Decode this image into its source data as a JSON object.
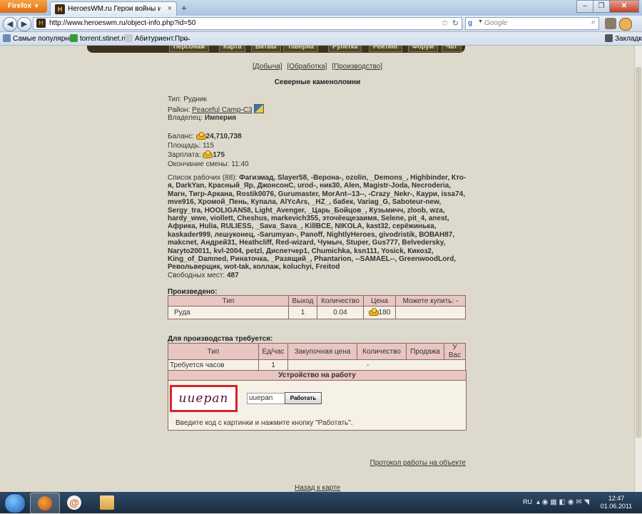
{
  "browser": {
    "app_button": "Firefox",
    "tab_title": "HeroesWM.ru Герои войны и денег. О...",
    "url": "http://www.heroeswm.ru/object-info.php?id=50",
    "search_placeholder": "Google",
    "search_engine_icon": "g",
    "bookmarks": [
      "Самые популярные",
      "torrent.stinet.ru",
      "Абитуриент.Про",
      "..."
    ],
    "bookmarks_menu": "Закладки"
  },
  "game_menu": [
    "Персонаж",
    "Карта",
    "Битвы",
    "Таверна",
    "Рулетка",
    "Рейтинг",
    "Форум",
    "Чат"
  ],
  "subnav": [
    "[Добыча]",
    "[Обработка]",
    "[Производство]"
  ],
  "object_title": "Северные каменоломни",
  "info": {
    "type_label": "Тип:",
    "type_value": "Рудник",
    "district_label": "Район:",
    "district_value": "Peaceful Camp-C3",
    "owner_label": "Владелец:",
    "owner_value": "Империя",
    "balance_label": "Баланс:",
    "balance_value": "24,710,738",
    "area_label": "Площадь:",
    "area_value": "115",
    "salary_label": "Зарплата:",
    "salary_value": "175",
    "shift_label": "Окончание смены:",
    "shift_value": "11:40"
  },
  "workers": {
    "label": "Список рабочих (88):",
    "names": "Фагизмад, Slayer58, -Верона-, ozolin, _Demons_, Highbinder, Кто-я, DarkYan, Красный_Яр, ДжонсонС, urod-, ник30, Alen, Magistr-Joda, Necroderia, Магн, Тигр-Аркана, Rostik0076, Gurumaster, MorAnt--13--, -Crazy_Nekr-, Каури, issa74, mve916, Хромой_Пень, Купала, AlYcArs, _HZ_, бабек, Variag_G, Saboteur-new, Sergy_tra, HOOLIGAN58, Light_Avenger, _Царь_Бойцов_, Кузьмичч, zloob, wza, hardy_wwe, viollett, Cheshus, markevich355, эточёещезаимя, Selene, pit_4, anest, Африка, Hulia, RULIESS, _Sava_Sava_, KillBCE, NIKOLA, kast32, серёжинька, kaskader999, лешуконец, -Sarumyan-, Panoff, NightlyHeroes, givodristik, ВОВАН87, makcnet, Андрей31, Heathcliff, Red-wizard, Чумыч, Stuper, Gus777, Belvedersky, Naryto20011, kvl-2004, petzl, Диспетчер1, Chumichka, ksn111, Yosick, Кикоз2, King_of_Damned, Ринаточка, _Разящий_, Phantarion, --SAMAEL--, GreenwoodLord, Револьверщик, wot-tak, коллаж, koluchyi, Freitod",
    "free_label": "Свободных мест:",
    "free_value": "487"
  },
  "produced": {
    "title": "Произведено:",
    "headers": [
      "Тип",
      "Выход",
      "Количество",
      "Цена",
      "Можете купить: -"
    ],
    "row": {
      "type": "Руда",
      "output": "1",
      "quantity": "0.04",
      "price": "180",
      "buy": ""
    }
  },
  "required": {
    "title": "Для производства требуется:",
    "headers": [
      "Тип",
      "Ед/час",
      "Закупочная цена",
      "Количество",
      "Продажа",
      "У Вас"
    ],
    "row": {
      "type": "Требуется часов",
      "per_hour": "1",
      "buy_price": "",
      "quantity": "-",
      "sale": "",
      "have": ""
    }
  },
  "employment": {
    "title": "Устройство на работу",
    "captcha_text": "uuepan",
    "input_value": "uuepan",
    "button": "Работать",
    "hint": "Введите код с картинки и нажмите кнопку \"Работать\"."
  },
  "links": {
    "protocol": "Протокол работы на объекте",
    "back": "Назад к карте"
  },
  "taskbar": {
    "lang": "RU",
    "time": "12:47",
    "date": "01.06.2011"
  }
}
